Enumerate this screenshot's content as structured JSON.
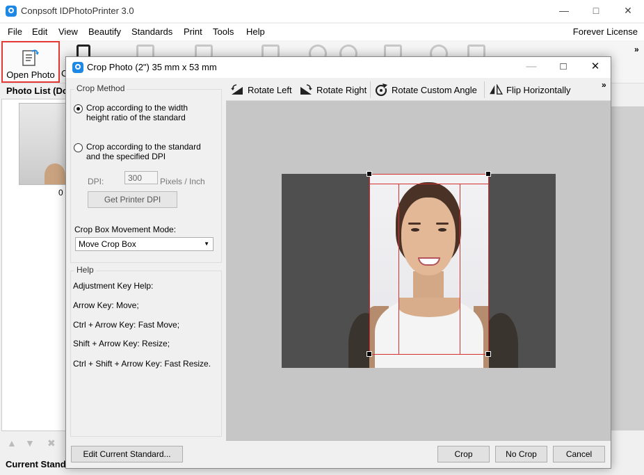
{
  "app": {
    "title": "Conpsoft IDPhotoPrinter 3.0",
    "license": "Forever License",
    "menu": [
      "File",
      "Edit",
      "View",
      "Beautify",
      "Standards",
      "Print",
      "Tools",
      "Help"
    ],
    "toolbar": {
      "open_photo": "Open Photo",
      "cut_label": "C"
    },
    "photo_list_header": "Photo List (Do",
    "thumb_label": "0",
    "current_standard": "Current Stand"
  },
  "dialog": {
    "title": "Crop Photo (2\") 35 mm x 53 mm",
    "toolbar": {
      "rotate_left": "Rotate Left",
      "rotate_right": "Rotate Right",
      "rotate_custom": "Rotate Custom Angle",
      "flip_h": "Flip Horizontally"
    },
    "crop_method": {
      "title": "Crop Method",
      "option1": "Crop according to the width height ratio of the standard",
      "option2": "Crop according to the standard and the specified DPI",
      "selected": "option1",
      "dpi_label": "DPI:",
      "dpi_value": "300",
      "dpi_unit": "Pixels / Inch",
      "get_printer_dpi": "Get Printer DPI",
      "movement_label": "Crop Box Movement Mode:",
      "movement_value": "Move Crop Box"
    },
    "help": {
      "title": "Help",
      "lines": [
        "Adjustment Key Help:",
        "Arrow Key: Move;",
        "Ctrl + Arrow Key: Fast Move;",
        "Shift + Arrow Key: Resize;",
        "Ctrl + Shift + Arrow Key: Fast Resize."
      ]
    },
    "buttons": {
      "edit_standard": "Edit Current Standard...",
      "crop": "Crop",
      "no_crop": "No Crop",
      "cancel": "Cancel"
    }
  }
}
